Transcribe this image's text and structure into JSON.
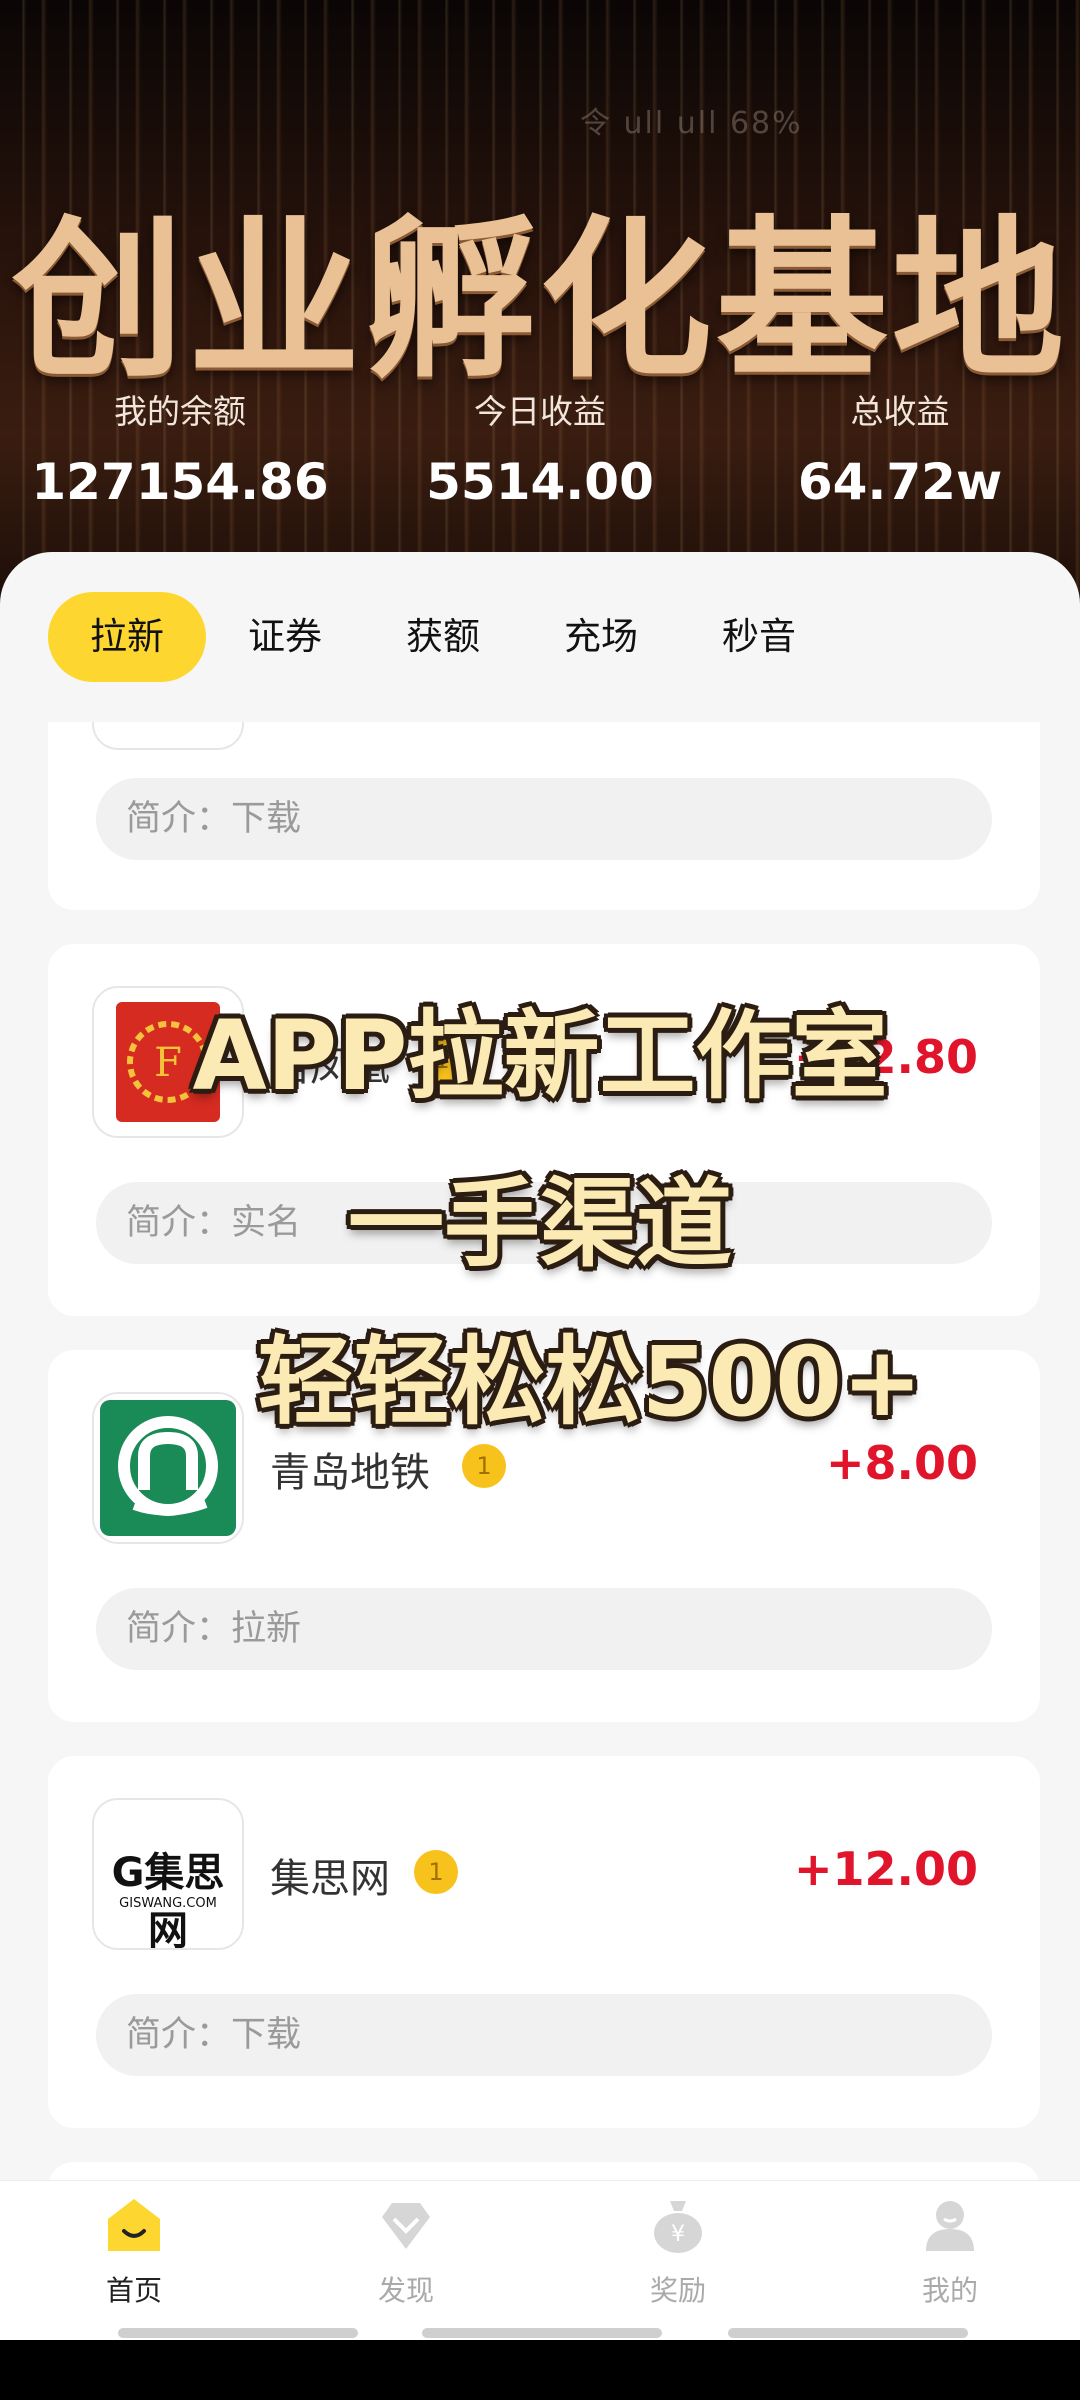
{
  "status": {
    "text": "令 ull ull 68%"
  },
  "hero": {
    "title": "创业孵化基地"
  },
  "stats": [
    {
      "label": "我的余额",
      "value": "127154.86"
    },
    {
      "label": "今日收益",
      "value": "5514.00"
    },
    {
      "label": "总收益",
      "value": "64.72w"
    }
  ],
  "tabs": [
    "拉新",
    "证券",
    "获额",
    "充场",
    "秒音"
  ],
  "cards": [
    {
      "desc": "简介：下载"
    },
    {
      "name": "君凤凰",
      "badge": "1",
      "reward": "+12.80",
      "desc": "简介：实名",
      "icon_label": "F"
    },
    {
      "name": "青岛地铁",
      "badge": "1",
      "reward": "+8.00",
      "desc": "简介：拉新"
    },
    {
      "name": "集思网",
      "badge": "1",
      "reward": "+12.00",
      "desc": "简介：下载",
      "icon_label": "G集思网",
      "icon_sub": "GISWANG.COM"
    }
  ],
  "overlay": {
    "line1": "APP拉新工作室",
    "line2": "一手渠道",
    "line3": "轻轻松松500+"
  },
  "nav": [
    {
      "label": "首页",
      "icon": "home-icon"
    },
    {
      "label": "发现",
      "icon": "discover-icon"
    },
    {
      "label": "奖励",
      "icon": "reward-icon"
    },
    {
      "label": "我的",
      "icon": "profile-icon"
    }
  ],
  "colors": {
    "accent": "#fdd72f",
    "reward": "#e0142a",
    "title": "#e9c195"
  }
}
